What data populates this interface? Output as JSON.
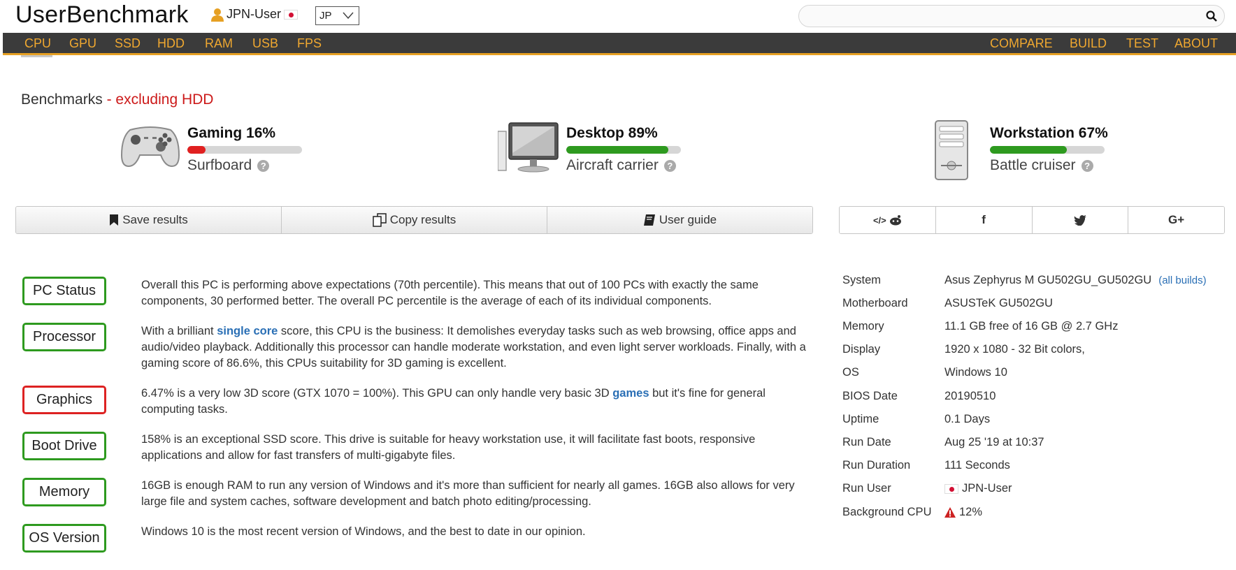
{
  "header": {
    "logo": "UserBenchmark",
    "user": "JPN-User",
    "locale": "JP",
    "search_placeholder": ""
  },
  "nav": {
    "left": [
      "CPU",
      "GPU",
      "SSD",
      "HDD",
      "RAM",
      "USB",
      "FPS"
    ],
    "right": [
      "COMPARE",
      "BUILD",
      "TEST",
      "ABOUT"
    ]
  },
  "benchmarks": {
    "title": "Benchmarks",
    "subtitle": "- excluding HDD",
    "items": [
      {
        "label": "Gaming 16%",
        "value": 16,
        "color": "#e02020",
        "rank": "Surfboard",
        "icon": "gamepad-icon"
      },
      {
        "label": "Desktop 89%",
        "value": 89,
        "color": "#2e9a1f",
        "rank": "Aircraft carrier",
        "icon": "desktop-icon"
      },
      {
        "label": "Workstation 67%",
        "value": 67,
        "color": "#2e9a1f",
        "rank": "Battle cruiser",
        "icon": "workstation-icon"
      }
    ]
  },
  "actions": {
    "save": "Save results",
    "copy": "Copy results",
    "guide": "User guide"
  },
  "social": {
    "reddit_embed": "</>",
    "facebook": "f",
    "twitter": "twitter",
    "googleplus": "G+"
  },
  "status": [
    {
      "badge": "PC Status",
      "color": "green",
      "parts": [
        "Overall this PC is performing above expectations (70th percentile). This means that out of 100 PCs with exactly the same components, 30 performed better. The overall PC percentile is the average of each of its individual components."
      ]
    },
    {
      "badge": "Processor",
      "color": "green",
      "pre": "With a brilliant ",
      "link": "single core",
      "post": " score, this CPU is the business: It demolishes everyday tasks such as web browsing, office apps and audio/video playback. Additionally this processor can handle moderate workstation, and even light server workloads. Finally, with a gaming score of 86.6%, this CPUs suitability for 3D gaming is excellent."
    },
    {
      "badge": "Graphics",
      "color": "red",
      "pre": "6.47% is a very low 3D score (GTX 1070 = 100%). This GPU can only handle very basic 3D ",
      "link": "games",
      "post": " but it's fine for general computing tasks."
    },
    {
      "badge": "Boot Drive",
      "color": "green",
      "parts": [
        "158% is an exceptional SSD score. This drive is suitable for heavy workstation use, it will facilitate fast boots, responsive applications and allow for fast transfers of multi-gigabyte files."
      ]
    },
    {
      "badge": "Memory",
      "color": "green",
      "parts": [
        "16GB is enough RAM to run any version of Windows and it's more than sufficient for nearly all games. 16GB also allows for very large file and system caches, software development and batch photo editing/processing."
      ]
    },
    {
      "badge": "OS Version",
      "color": "green",
      "parts": [
        "Windows 10 is the most recent version of Windows, and the best to date in our opinion."
      ]
    }
  ],
  "spec": {
    "system": {
      "k": "System",
      "v": "Asus Zephyrus M GU502GU_GU502GU",
      "link": "(all builds)"
    },
    "motherboard": {
      "k": "Motherboard",
      "v": "ASUSTeK GU502GU"
    },
    "memory": {
      "k": "Memory",
      "v": "11.1 GB free of 16 GB @ 2.7 GHz"
    },
    "display": {
      "k": "Display",
      "v": "1920 x 1080 - 32 Bit colors,"
    },
    "os": {
      "k": "OS",
      "v": "Windows 10"
    },
    "bios": {
      "k": "BIOS Date",
      "v": "20190510"
    },
    "uptime": {
      "k": "Uptime",
      "v": "0.1 Days"
    },
    "rundate": {
      "k": "Run Date",
      "v": "Aug 25 '19 at 10:37"
    },
    "runduration": {
      "k": "Run Duration",
      "v": "111 Seconds"
    },
    "runuser": {
      "k": "Run User",
      "v": "JPN-User"
    },
    "bgcpu": {
      "k": "Background CPU",
      "v": "12%"
    }
  }
}
